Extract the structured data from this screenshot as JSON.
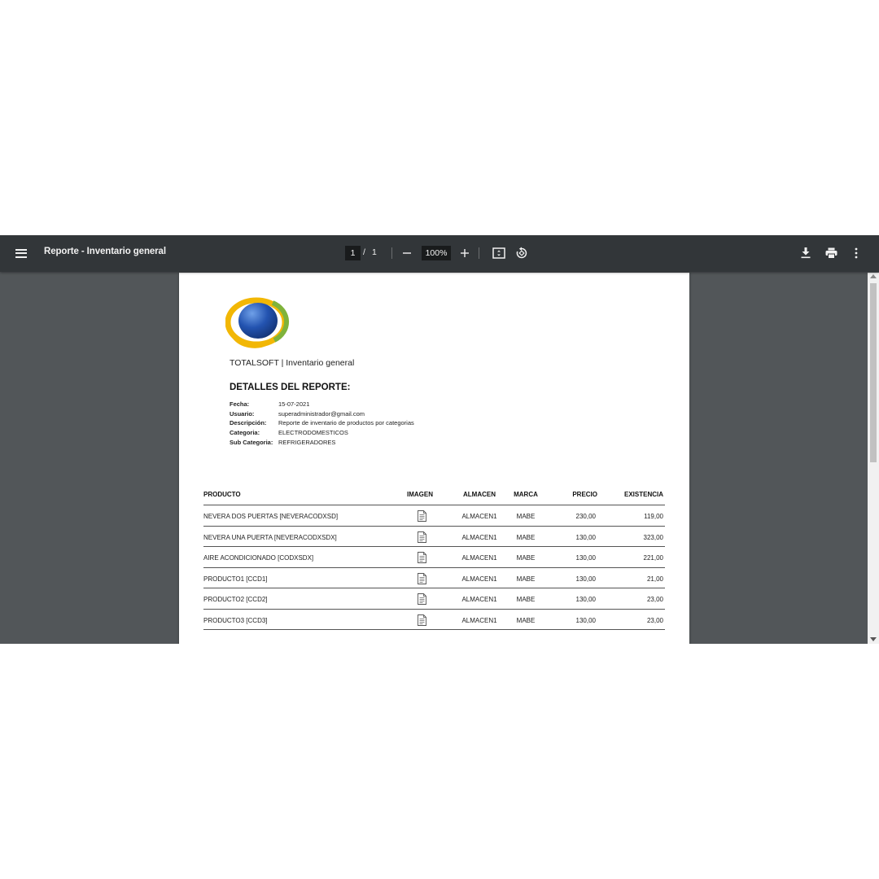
{
  "toolbar": {
    "title": "Reporte - Inventario general",
    "page_current": "1",
    "page_separator": "/",
    "page_total": "1",
    "zoom": "100%",
    "icons": [
      "menu-icon",
      "zoom-out-icon",
      "zoom-in-icon",
      "fit-page-icon",
      "rotate-icon",
      "download-icon",
      "print-icon",
      "more-icon"
    ]
  },
  "report": {
    "company": "TOTALSOFT | Inventario general",
    "section_title": "DETALLES DEL REPORTE:",
    "details": [
      {
        "key": "Fecha:",
        "value": "15-07-2021"
      },
      {
        "key": "Usuario:",
        "value": "superadministrador@gmail.com"
      },
      {
        "key": "Descripción:",
        "value": "Reporte de inventario de productos por categorias"
      },
      {
        "key": "Categoria:",
        "value": "ELECTRODOMESTICOS"
      },
      {
        "key": "Sub Categoria:",
        "value": "REFRIGERADORES"
      }
    ],
    "table": {
      "headers": {
        "producto": "PRODUCTO",
        "imagen": "IMAGEN",
        "almacen": "ALMACEN",
        "marca": "MARCA",
        "precio": "PRECIO",
        "existencia": "EXISTENCIA"
      },
      "rows": [
        {
          "producto": "NEVERA DOS PUERTAS [NEVERACODXSD]",
          "almacen": "ALMACEN1",
          "marca": "MABE",
          "precio": "230,00",
          "existencia": "119,00"
        },
        {
          "producto": "NEVERA UNA PUERTA [NEVERACODXSDX]",
          "almacen": "ALMACEN1",
          "marca": "MABE",
          "precio": "130,00",
          "existencia": "323,00"
        },
        {
          "producto": "AIRE ACONDICIONADO [CODXSDX]",
          "almacen": "ALMACEN1",
          "marca": "MABE",
          "precio": "130,00",
          "existencia": "221,00"
        },
        {
          "producto": "PRODUCTO1 [CCD1]",
          "almacen": "ALMACEN1",
          "marca": "MABE",
          "precio": "130,00",
          "existencia": "21,00"
        },
        {
          "producto": "PRODUCTO2 [CCD2]",
          "almacen": "ALMACEN1",
          "marca": "MABE",
          "precio": "130,00",
          "existencia": "23,00"
        },
        {
          "producto": "PRODUCTO3 [CCD3]",
          "almacen": "ALMACEN1",
          "marca": "MABE",
          "precio": "130,00",
          "existencia": "23,00"
        }
      ]
    }
  },
  "colors": {
    "toolbar_bg": "#323639",
    "viewer_bg": "#525659",
    "logo_blue": "#1f4fa3",
    "logo_yellow": "#f2b705",
    "logo_green": "#7fb33b"
  }
}
